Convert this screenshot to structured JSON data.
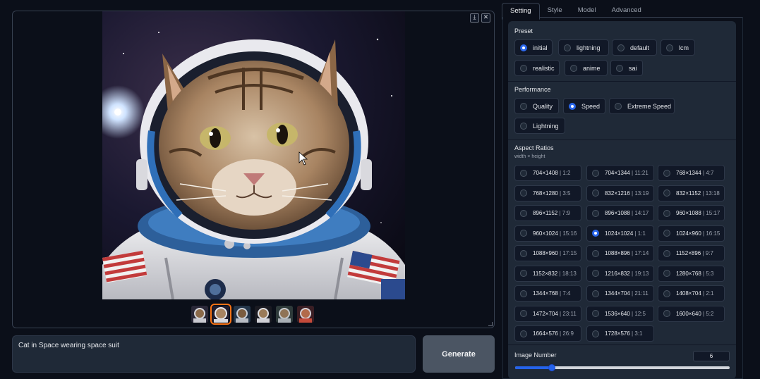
{
  "gallery": {
    "download_icon": "download-icon",
    "close_icon": "close-icon",
    "thumbnail_count": 6,
    "selected_thumbnail": 1
  },
  "prompt": {
    "value": "Cat in Space wearing space suit"
  },
  "generate_label": "Generate",
  "tabs": [
    "Setting",
    "Style",
    "Model",
    "Advanced"
  ],
  "active_tab": "Setting",
  "preset": {
    "title": "Preset",
    "options": [
      "initial",
      "lightning",
      "default",
      "lcm",
      "realistic",
      "anime",
      "sai"
    ],
    "selected": "initial"
  },
  "performance": {
    "title": "Performance",
    "options": [
      "Quality",
      "Speed",
      "Extreme Speed",
      "Lightning"
    ],
    "selected": "Speed"
  },
  "aspect": {
    "title": "Aspect Ratios",
    "subtitle": "width × height",
    "options": [
      {
        "size": "704×1408",
        "ratio": "1:2"
      },
      {
        "size": "704×1344",
        "ratio": "11:21"
      },
      {
        "size": "768×1344",
        "ratio": "4:7"
      },
      {
        "size": "768×1280",
        "ratio": "3:5"
      },
      {
        "size": "832×1216",
        "ratio": "13:19"
      },
      {
        "size": "832×1152",
        "ratio": "13:18"
      },
      {
        "size": "896×1152",
        "ratio": "7:9"
      },
      {
        "size": "896×1088",
        "ratio": "14:17"
      },
      {
        "size": "960×1088",
        "ratio": "15:17"
      },
      {
        "size": "960×1024",
        "ratio": "15:16"
      },
      {
        "size": "1024×1024",
        "ratio": "1:1"
      },
      {
        "size": "1024×960",
        "ratio": "16:15"
      },
      {
        "size": "1088×960",
        "ratio": "17:15"
      },
      {
        "size": "1088×896",
        "ratio": "17:14"
      },
      {
        "size": "1152×896",
        "ratio": "9:7"
      },
      {
        "size": "1152×832",
        "ratio": "18:13"
      },
      {
        "size": "1216×832",
        "ratio": "19:13"
      },
      {
        "size": "1280×768",
        "ratio": "5:3"
      },
      {
        "size": "1344×768",
        "ratio": "7:4"
      },
      {
        "size": "1344×704",
        "ratio": "21:11"
      },
      {
        "size": "1408×704",
        "ratio": "2:1"
      },
      {
        "size": "1472×704",
        "ratio": "23:11"
      },
      {
        "size": "1536×640",
        "ratio": "12:5"
      },
      {
        "size": "1600×640",
        "ratio": "5:2"
      },
      {
        "size": "1664×576",
        "ratio": "26:9"
      },
      {
        "size": "1728×576",
        "ratio": "3:1"
      }
    ],
    "selected_index": 10
  },
  "image_number": {
    "label": "Image Number",
    "value": "6",
    "fraction": 0.17
  },
  "colors": {
    "accent": "#2563eb",
    "selected_thumb": "#f97316",
    "panel": "#1f2937",
    "background": "#0b0f19"
  }
}
